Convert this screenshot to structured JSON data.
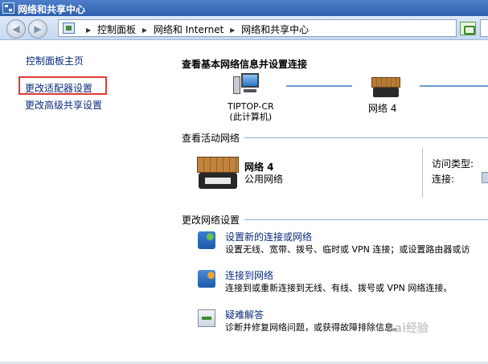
{
  "window": {
    "title": "网络和共享中心"
  },
  "nav": {
    "breadcrumbs": [
      "控制面板",
      "网络和 Internet",
      "网络和共享中心"
    ]
  },
  "sidebar": {
    "items": [
      {
        "label": "控制面板主页"
      },
      {
        "label": "更改适配器设置",
        "highlighted": true
      },
      {
        "label": "更改高级共享设置"
      }
    ]
  },
  "main": {
    "title": "查看基本网络信息并设置连接",
    "computer": {
      "name": "TIPTOP-CR",
      "note": "(此计算机)"
    },
    "network_map_label": "网络  4",
    "active_section": "查看活动网络",
    "active_network": {
      "name": "网络   4",
      "type": "公用网络",
      "access_type_label": "访问类型:",
      "connection_label": "连接:"
    },
    "settings_section": "更改网络设置",
    "tasks": [
      {
        "title": "设置新的连接或网络",
        "desc": "设置无线、宽带、拨号、临时或 VPN 连接；或设置路由器或访",
        "icon": "network-setup-icon"
      },
      {
        "title": "连接到网络",
        "desc": "连接到或重新连接到无线、有线、拨号或 VPN 网络连接。",
        "icon": "connect-network-icon"
      },
      {
        "title": "疑难解答",
        "desc": "诊断并修复网络问题，或获得故障排除信息。",
        "icon": "troubleshoot-icon"
      }
    ]
  },
  "watermark": "Bai经验",
  "colors": {
    "highlight_box": "#e03a3a",
    "link": "#0a2a7a",
    "titlebar": "#2d5fae"
  }
}
